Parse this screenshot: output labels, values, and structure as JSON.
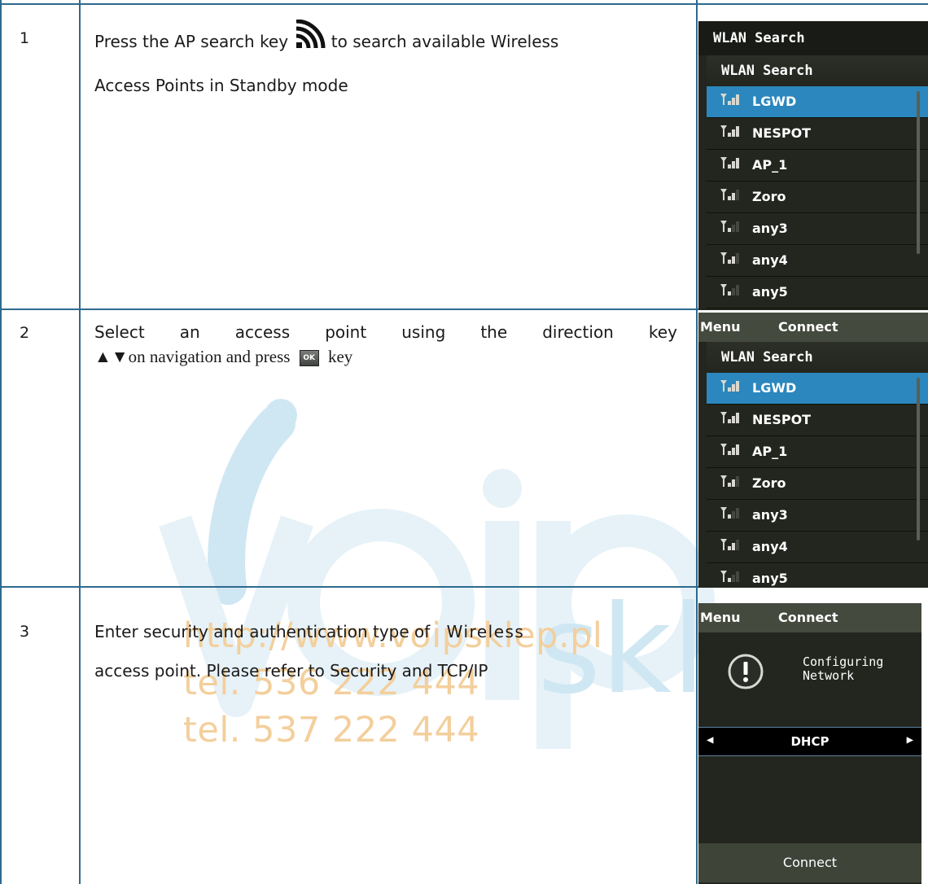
{
  "rows": [
    {
      "number": "1",
      "text_before_icon": "Press the AP search key",
      "text_after_icon": "to search available Wireless",
      "line2": "Access Points in Standby mode"
    },
    {
      "number": "2",
      "words": [
        "Select",
        "an",
        "access",
        "point",
        "using",
        "the",
        "direction",
        "key"
      ],
      "arrows": "▲▼",
      "line2_text": "on navigation and press",
      "ok_key_label": "OK",
      "line2_end": "key"
    },
    {
      "number": "3",
      "line1": "Enter security and authentication type of",
      "line1_spaced": "Wireless",
      "line2": "access point. Please refer to Security and TCP/IP"
    }
  ],
  "screens": {
    "header_title": "WLAN Search",
    "list_title": "WLAN Search",
    "access_points": [
      "LGWD",
      "NESPOT",
      "AP_1",
      "Zoro",
      "any3",
      "any4",
      "any5"
    ],
    "selected_index": 0,
    "signal_levels": [
      3,
      3,
      3,
      2,
      1,
      2,
      1
    ],
    "softkey_left": "Menu",
    "softkey_center": "Connect",
    "status_text_line1": "Configuring",
    "status_text_line2": "Network",
    "ip_mode": "DHCP",
    "bottom_softkey": "Connect"
  },
  "watermark": {
    "url": "http://www.voipsklep.pl",
    "phone1": "tel. 536 222 444",
    "phone2": "tel. 537 222 444",
    "brand_word": "sklep",
    "brand_prefix": "voip"
  },
  "colors": {
    "border": "#2e6a8e",
    "selected_row": "#2b87bd",
    "watermark_blue": "#cfe7f3",
    "watermark_orange": "#f3cf9c",
    "screen_bg": "#23261e"
  }
}
